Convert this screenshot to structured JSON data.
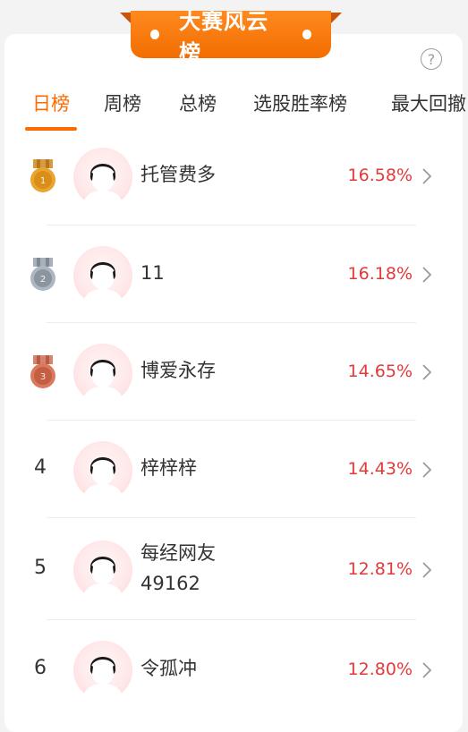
{
  "banner": {
    "title": "大赛风云榜"
  },
  "help": {
    "symbol": "?"
  },
  "tabs": [
    {
      "label": "日榜"
    },
    {
      "label": "周榜"
    },
    {
      "label": "总榜"
    },
    {
      "label": "选股胜率榜"
    },
    {
      "label": "最大回撤"
    }
  ],
  "colors": {
    "accent": "#ff6a00",
    "value_red": "#e03a3a"
  },
  "rows": [
    {
      "rank": "1",
      "name": "托管费多",
      "value": "16.58%",
      "medal": "gold"
    },
    {
      "rank": "2",
      "name": "11",
      "value": "16.18%",
      "medal": "silver"
    },
    {
      "rank": "3",
      "name": "博爱永存",
      "value": "14.65%",
      "medal": "bronze"
    },
    {
      "rank": "4",
      "name": "梓梓梓",
      "value": "14.43%"
    },
    {
      "rank": "5",
      "name_line1": "每经网友",
      "name_line2": "49162",
      "value": "12.81%"
    },
    {
      "rank": "6",
      "name": "令孤冲",
      "value": "12.80%"
    }
  ]
}
